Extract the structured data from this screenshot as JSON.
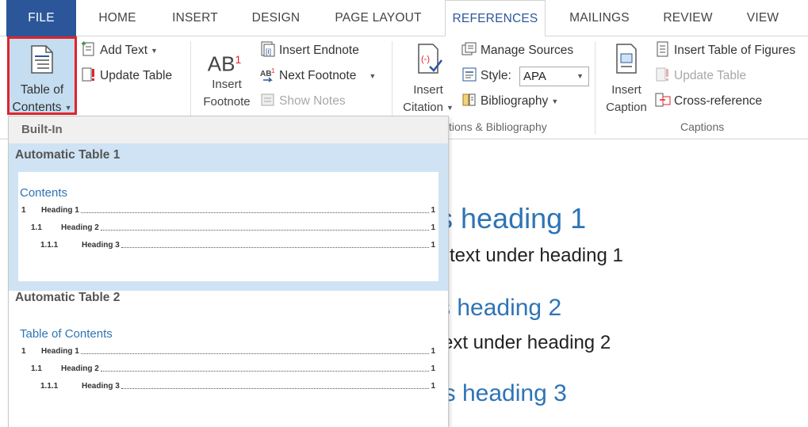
{
  "tabs": [
    "FILE",
    "HOME",
    "INSERT",
    "DESIGN",
    "PAGE LAYOUT",
    "REFERENCES",
    "MAILINGS",
    "REVIEW",
    "VIEW"
  ],
  "toc_group": {
    "toc_button": {
      "line1": "Table of",
      "line2": "Contents",
      "icon": "table-of-contents-icon"
    },
    "add_text": "Add Text",
    "update_table": "Update Table"
  },
  "footnotes_group": {
    "insert_footnote": {
      "line1": "Insert",
      "line2": "Footnote",
      "icon_text": "AB",
      "icon_sup": "1"
    },
    "insert_endnote": "Insert Endnote",
    "next_footnote": "Next Footnote",
    "show_notes": "Show Notes"
  },
  "citations_group": {
    "insert_citation": {
      "line1": "Insert",
      "line2": "Citation"
    },
    "manage_sources": "Manage Sources",
    "style_label": "Style:",
    "style_value": "APA",
    "bibliography": "Bibliography",
    "group_label": "tions & Bibliography"
  },
  "captions_group": {
    "insert_caption": {
      "line1": "Insert",
      "line2": "Caption"
    },
    "insert_table_of_figures": "Insert Table of Figures",
    "update_table": "Update Table",
    "cross_reference": "Cross-reference",
    "group_label": "Captions"
  },
  "dropdown": {
    "section": "Built-In",
    "items": [
      {
        "name": "Automatic Table 1",
        "preview_title": "Contents",
        "lines": [
          {
            "num": "1",
            "text": "Heading 1",
            "page": "1"
          },
          {
            "num": "1.1",
            "text": "Heading 2",
            "page": "1"
          },
          {
            "num": "1.1.1",
            "text": "Heading 3",
            "page": "1"
          }
        ]
      },
      {
        "name": "Automatic Table 2",
        "preview_title": "Table of Contents",
        "lines": [
          {
            "num": "1",
            "text": "Heading 1",
            "page": "1"
          },
          {
            "num": "1.1",
            "text": "Heading 2",
            "page": "1"
          },
          {
            "num": "1.1.1",
            "text": "Heading 3",
            "page": "1"
          }
        ]
      }
    ]
  },
  "document": {
    "h1": "s heading 1",
    "t1": "l text under heading 1",
    "h2": "s heading 2",
    "t2": "ext under heading 2",
    "h3": "is heading 3"
  },
  "colors": {
    "accent": "#2b579a",
    "heading": "#2e74b5",
    "highlight": "#c5ddf0",
    "selection_border": "#e0232a"
  }
}
